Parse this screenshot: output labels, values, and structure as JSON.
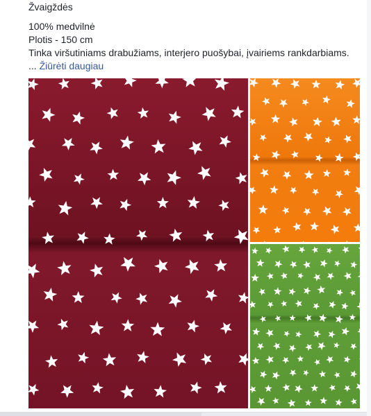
{
  "post": {
    "title": "Žvaigždės",
    "lines": [
      "100% medvilnė",
      "Plotis - 150 cm",
      "Tinka viršutiniams drabužiams, interjero puošybai, įvairiems rankdarbiams."
    ],
    "ellipsis": "... ",
    "see_more": "Žiūrėti daugiau"
  },
  "photos": [
    {
      "name": "burgundy-star-fabric",
      "color": "#7a1426",
      "star_color": "#ffffff"
    },
    {
      "name": "orange-star-fabric",
      "color": "#f27b0c",
      "star_color": "#ffffff"
    },
    {
      "name": "green-star-fabric",
      "color": "#5d9c36",
      "star_color": "#ffffff"
    }
  ]
}
